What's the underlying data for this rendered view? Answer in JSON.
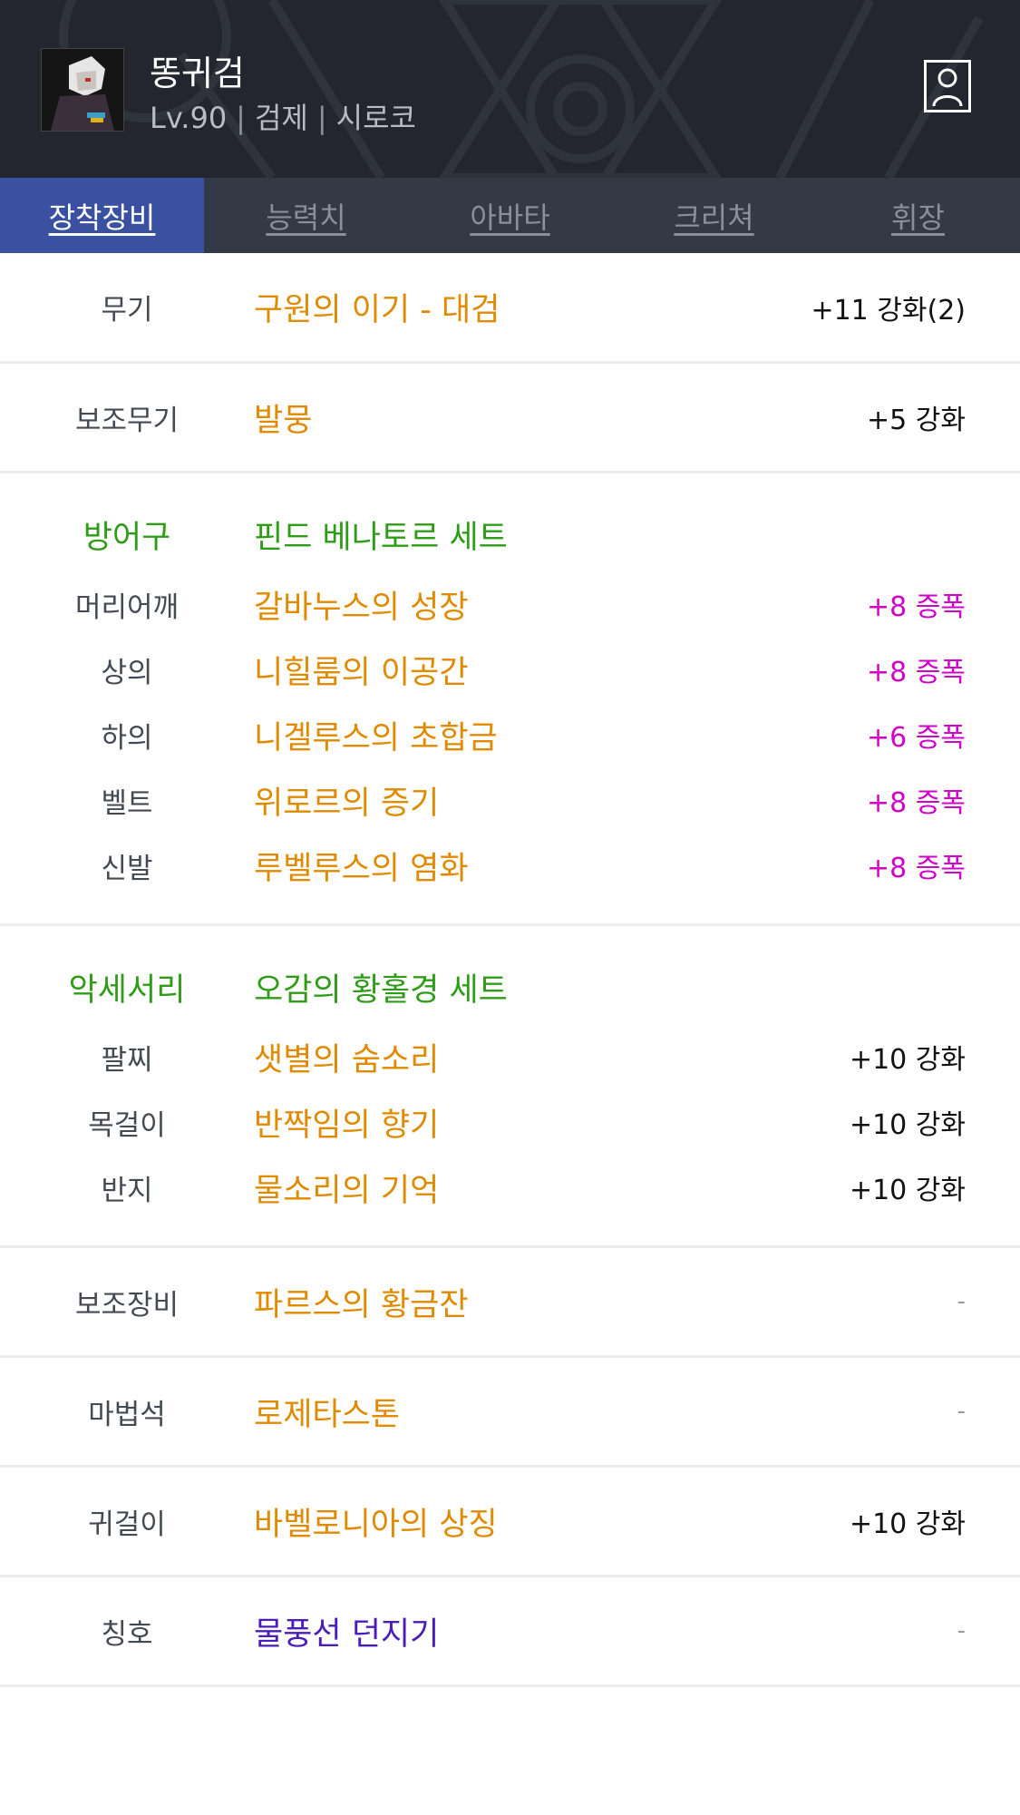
{
  "header": {
    "character_name": "똥귀검",
    "level": "Lv.90",
    "job": "검제",
    "server": "시로코",
    "separator": "|"
  },
  "tabs": [
    {
      "label": "장착장비",
      "active": true
    },
    {
      "label": "능력치",
      "active": false
    },
    {
      "label": "아바타",
      "active": false
    },
    {
      "label": "크리쳐",
      "active": false
    },
    {
      "label": "휘장",
      "active": false
    }
  ],
  "equipment": {
    "weapon": {
      "slot": "무기",
      "item": "구원의 이기 - 대검",
      "stat": "+11 강화(2)"
    },
    "subweapon": {
      "slot": "보조무기",
      "item": "발뭉",
      "stat": "+5 강화"
    },
    "armor": {
      "slot": "방어구",
      "set_name": "핀드 베나토르 세트",
      "items": [
        {
          "slot": "머리어깨",
          "item": "갈바누스의 성장",
          "stat": "+8 증폭"
        },
        {
          "slot": "상의",
          "item": "니힐룸의 이공간",
          "stat": "+8 증폭"
        },
        {
          "slot": "하의",
          "item": "니겔루스의 초합금",
          "stat": "+6 증폭"
        },
        {
          "slot": "벨트",
          "item": "위로르의 증기",
          "stat": "+8 증폭"
        },
        {
          "slot": "신발",
          "item": "루벨루스의 염화",
          "stat": "+8 증폭"
        }
      ]
    },
    "accessory": {
      "slot": "악세서리",
      "set_name": "오감의 황홀경 세트",
      "items": [
        {
          "slot": "팔찌",
          "item": "샛별의 숨소리",
          "stat": "+10 강화"
        },
        {
          "slot": "목걸이",
          "item": "반짝임의 향기",
          "stat": "+10 강화"
        },
        {
          "slot": "반지",
          "item": "물소리의 기억",
          "stat": "+10 강화"
        }
      ]
    },
    "subequip": {
      "slot": "보조장비",
      "item": "파르스의 황금잔",
      "stat": "-"
    },
    "magicstone": {
      "slot": "마법석",
      "item": "로제타스톤",
      "stat": "-"
    },
    "earring": {
      "slot": "귀걸이",
      "item": "바벨로니아의 상징",
      "stat": "+10 강화"
    },
    "title": {
      "slot": "칭호",
      "item": "물풍선 던지기",
      "stat": "-"
    }
  },
  "colors": {
    "header_bg": "#23262e",
    "tab_bar": "#333945",
    "tab_active": "#3a50a0",
    "item_orange": "#e08a00",
    "set_green": "#2f9c17",
    "amplify_magenta": "#d200c8",
    "title_purple": "#4a1cb8"
  }
}
